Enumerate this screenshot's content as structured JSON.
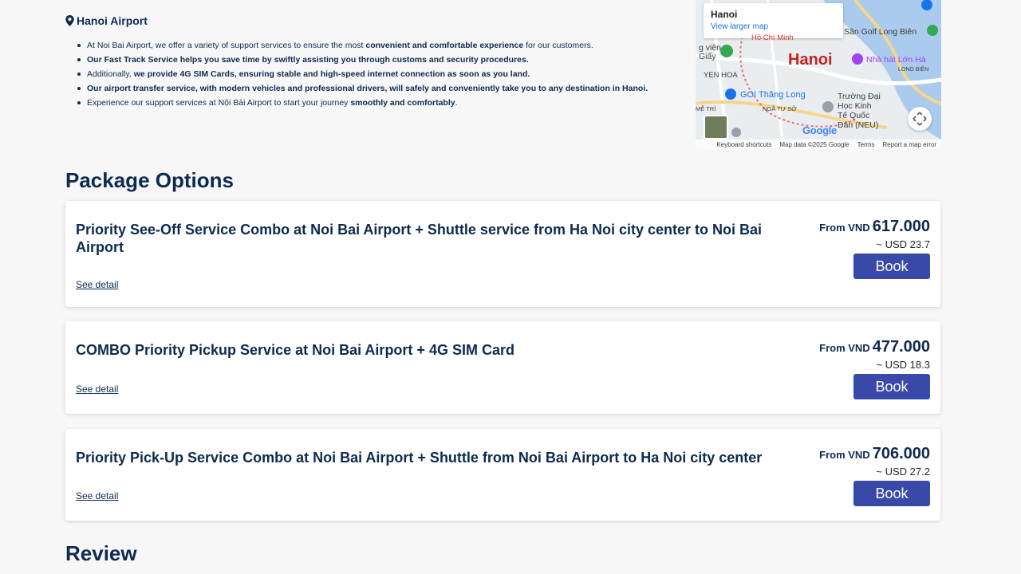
{
  "location": {
    "title": "Hanoi Airport",
    "bullets": [
      {
        "parts": [
          {
            "text": "At Noi Bai Airport, we offer a variety of support services to ensure the most ",
            "bold": false
          },
          {
            "text": "convenient and comfortable experience",
            "bold": true
          },
          {
            "text": " for our customers.",
            "bold": false
          }
        ]
      },
      {
        "parts": [
          {
            "text": "Our Fast Track Service helps you save time by swiftly assisting you through customs and security procedures.",
            "bold": true
          }
        ]
      },
      {
        "parts": [
          {
            "text": "Additionally, ",
            "bold": false
          },
          {
            "text": "we provide 4G SIM Cards, ensuring stable and high-speed internet connection as soon as you land.",
            "bold": true
          }
        ]
      },
      {
        "parts": [
          {
            "text": "Our airport transfer service, with modern vehicles and professional drivers, will safely and conveniently take you to any destination in Hanoi.",
            "bold": true
          }
        ]
      },
      {
        "parts": [
          {
            "text": "Experience our support services at Nội Bài Airport to start your journey ",
            "bold": false
          },
          {
            "text": "smoothly and comfortably",
            "bold": true
          },
          {
            "text": ".",
            "bold": false
          }
        ]
      }
    ]
  },
  "map": {
    "place": "Hanoi",
    "larger_link": "View larger map",
    "city_label": "Hanoi",
    "labels": {
      "golf": "Sân Golf Long Biên",
      "opera": "Nhà hát Lớn Hà",
      "yenhoa": "YEN HOA",
      "thanglong": "GO! Thăng Long",
      "university": "Trường Đại\nHọc Kinh\nTế Quốc\nDân (NEU)",
      "longbien": "LONG BIÊN",
      "giay": "Giấy",
      "vien": "g viên",
      "hcm": "Hồ Chí Minh",
      "tuso": "NGÃ TƯ SỞ",
      "metri": "MỄ TRÌ"
    },
    "google": "Google",
    "footer": {
      "shortcuts": "Keyboard shortcuts",
      "data": "Map data ©2025 Google",
      "terms": "Terms",
      "report": "Report a map error"
    }
  },
  "packages_heading": "Package Options",
  "packages": [
    {
      "name": "Priority See-Off Service Combo at Noi Bai Airport + Shuttle service from Ha Noi city center to Noi Bai Airport",
      "from_label": "From",
      "currency": "VND",
      "price": "617.000",
      "usd": "~ USD 23.7",
      "book_label": "Book",
      "detail_label": "See detail"
    },
    {
      "name": "COMBO Priority Pickup Service at Noi Bai Airport + 4G SIM Card",
      "from_label": "From",
      "currency": "VND",
      "price": "477.000",
      "usd": "~ USD 18.3",
      "book_label": "Book",
      "detail_label": "See detail"
    },
    {
      "name": "Priority Pick-Up Service Combo at Noi Bai Airport + Shuttle from Noi Bai Airport to Ha Noi city center",
      "from_label": "From",
      "currency": "VND",
      "price": "706.000",
      "usd": "~ USD 27.2",
      "book_label": "Book",
      "detail_label": "See detail"
    }
  ],
  "review_heading": "Review",
  "colors": {
    "heading": "#0d2a4f",
    "book_button": "#3849a8",
    "map_city": "#c5221f",
    "map_link": "#1a73e8"
  },
  "icons": {
    "location": "map-pin-icon",
    "fullscreen": "fullscreen-icon"
  }
}
